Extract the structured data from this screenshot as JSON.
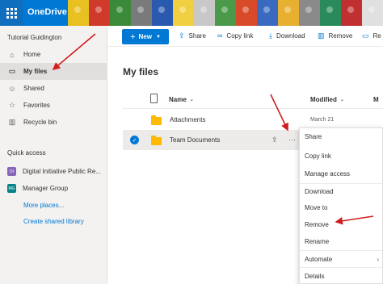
{
  "app": {
    "brand": "OneDrive"
  },
  "header": {
    "lego_colors": [
      "#e8c020",
      "#d03a2a",
      "#3a8a3a",
      "#7a7a7a",
      "#2a5ab0",
      "#f0d040",
      "#c8c8c8",
      "#4a9a4a",
      "#d84a2a",
      "#3a6ac0",
      "#e8b030",
      "#8a8a8a",
      "#2a8a5a",
      "#c03030",
      "#e0e0e0"
    ]
  },
  "sidebar": {
    "tenant": "Tutorial Guidington",
    "nav": [
      {
        "label": "Home",
        "icon": "home-icon"
      },
      {
        "label": "My files",
        "icon": "folder-icon",
        "active": true
      },
      {
        "label": "Shared",
        "icon": "people-icon"
      },
      {
        "label": "Favorites",
        "icon": "star-icon"
      },
      {
        "label": "Recycle bin",
        "icon": "trash-icon"
      }
    ],
    "quick_access_label": "Quick access",
    "quick_access": [
      {
        "badge": "DI",
        "label": "Digital Initiative Public Re...",
        "color": "#8764b8"
      },
      {
        "badge": "MG",
        "label": "Manager Group",
        "color": "#038387"
      }
    ],
    "more_places": "More places...",
    "create_library": "Create shared library"
  },
  "commandbar": {
    "new_label": "New",
    "share_label": "Share",
    "copy_link_label": "Copy link",
    "download_label": "Download",
    "remove_label": "Remove",
    "more_label": "Re"
  },
  "main": {
    "title": "My files",
    "columns": {
      "name": "Name",
      "modified": "Modified",
      "more": "M"
    },
    "files": [
      {
        "name": "Attachments",
        "modified": "March 21"
      },
      {
        "name": "Team Documents",
        "modified": ""
      }
    ]
  },
  "context_menu": {
    "items": [
      {
        "label": "Share"
      },
      {
        "label": "Copy link"
      },
      {
        "label": "Manage access"
      },
      {
        "label": "Download"
      },
      {
        "label": "Move to"
      },
      {
        "label": "Remove"
      },
      {
        "label": "Rename"
      },
      {
        "label": "Automate"
      },
      {
        "label": "Details"
      }
    ]
  }
}
